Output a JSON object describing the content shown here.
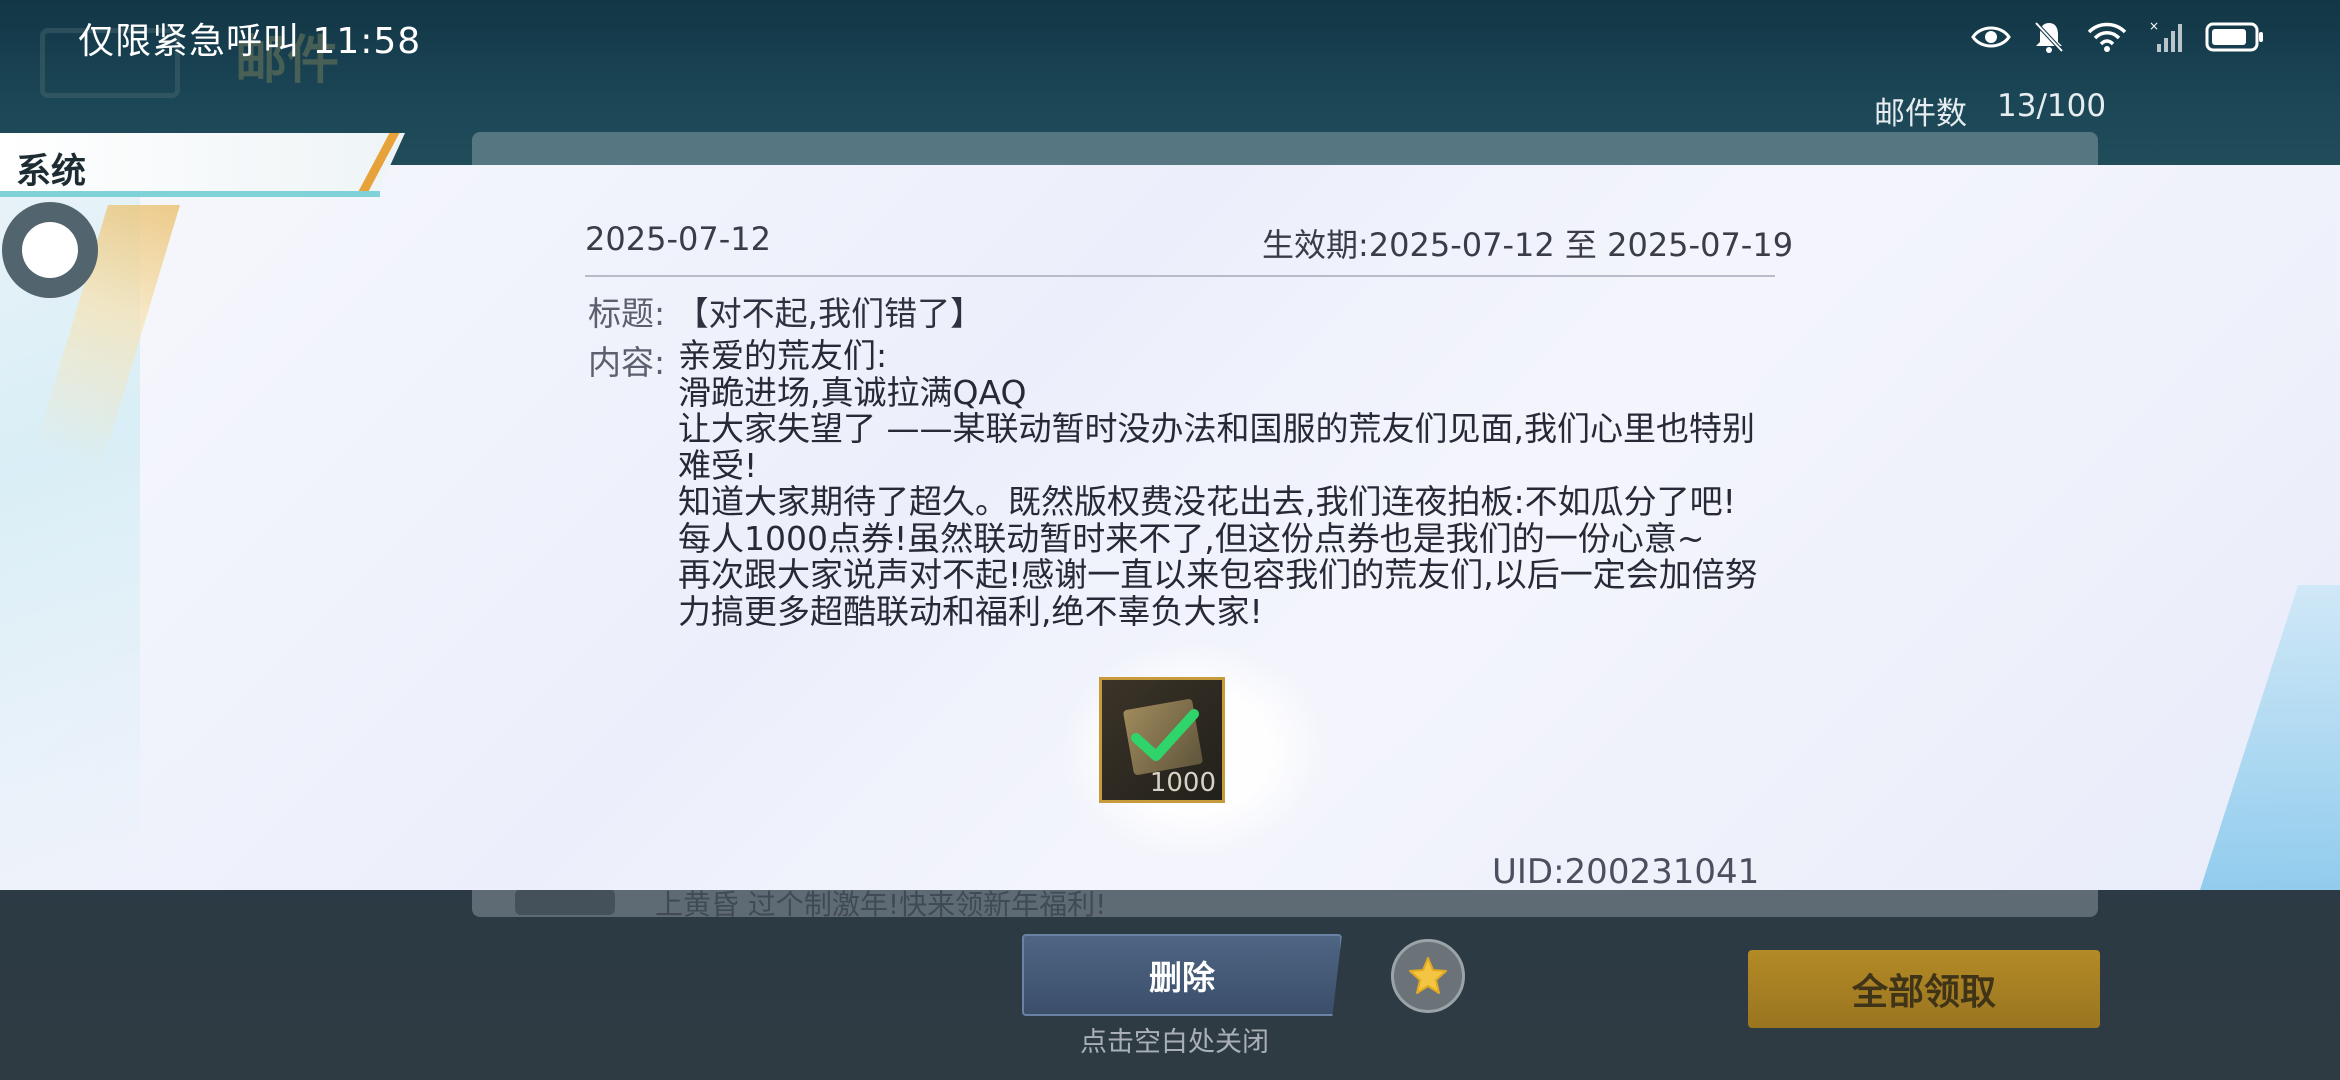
{
  "status_bar": {
    "left_text": "仅限紧急呼叫 11:58",
    "icons": [
      "eye-icon",
      "bell-muted-icon",
      "wifi-icon",
      "signal-icon",
      "battery-icon"
    ]
  },
  "header": {
    "faded_title": "邮件",
    "mail_count_label": "邮件数",
    "mail_count_value": "13/100"
  },
  "sidebar": {
    "tab_label": "系统"
  },
  "mail": {
    "date": "2025-07-12",
    "validity": "生效期:2025-07-12 至 2025-07-19",
    "subject_label": "标题:",
    "subject": "【对不起,我们错了】",
    "content_label": "内容:",
    "content_lines": [
      "亲爱的荒友们:",
      "滑跪进场,真诚拉满QAQ",
      "让大家失望了 ——某联动暂时没办法和国服的荒友们见面,我们心里也特别难受!",
      "知道大家期待了超久。既然版权费没花出去,我们连夜拍板:不如瓜分了吧!每人1000点券!虽然联动暂时来不了,但这份点券也是我们的一份心意~",
      "再次跟大家说声对不起!感谢一直以来包容我们的荒友们,以后一定会加倍努力搞更多超酷联动和福利,绝不辜负大家!"
    ],
    "reward": {
      "count": "1000",
      "claimed": true
    },
    "uid": "UID:200231041"
  },
  "background_list": {
    "row_text": "上黄昏 过个制激年!快来领新年福利!"
  },
  "actions": {
    "delete_label": "删除",
    "close_hint": "点击空白处关闭",
    "claim_all_label": "全部领取"
  }
}
